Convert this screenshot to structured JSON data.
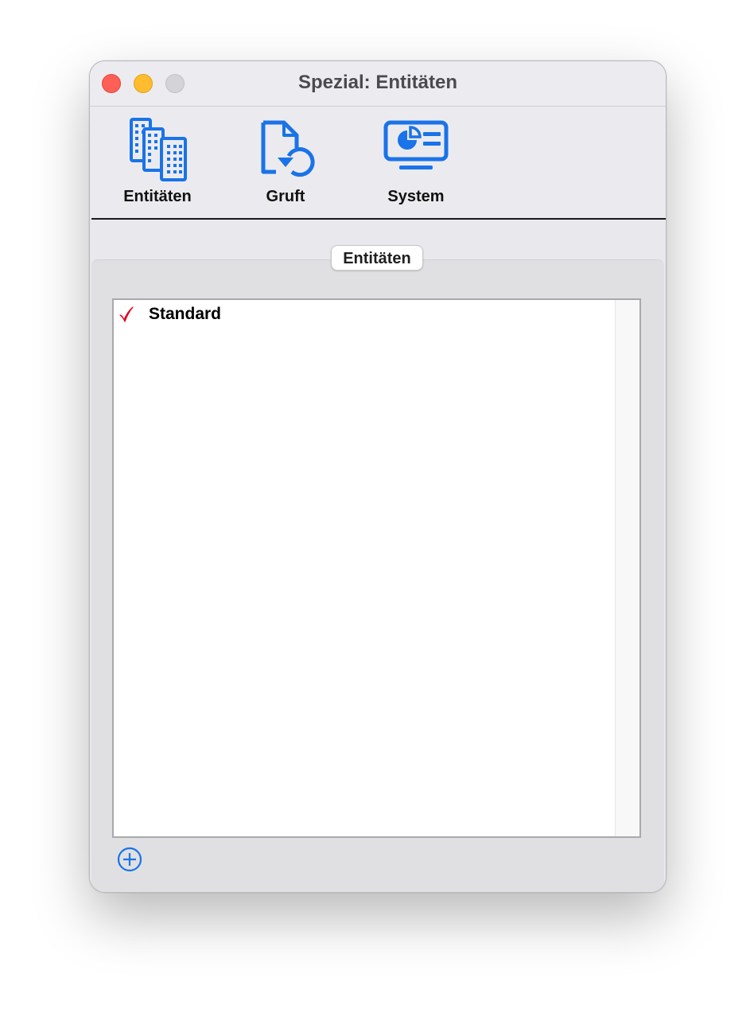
{
  "window": {
    "title": "Spezial: Entitäten"
  },
  "toolbar": {
    "items": [
      {
        "label": "Entitäten",
        "icon": "buildings-icon",
        "selected": true
      },
      {
        "label": "Gruft",
        "icon": "document-restore-icon",
        "selected": false
      },
      {
        "label": "System",
        "icon": "monitor-icon",
        "selected": false
      }
    ]
  },
  "group": {
    "label": "Entitäten"
  },
  "list": {
    "items": [
      {
        "label": "Standard",
        "checked": true,
        "check_icon": "checkmark-icon"
      }
    ]
  },
  "add_button": {
    "icon": "plus-circle-icon"
  },
  "colors": {
    "accent": "#1a73e8",
    "check": "#e0001b",
    "close": "#fe5f57",
    "minimize": "#febc2e",
    "zoom": "#d4d4d8"
  }
}
